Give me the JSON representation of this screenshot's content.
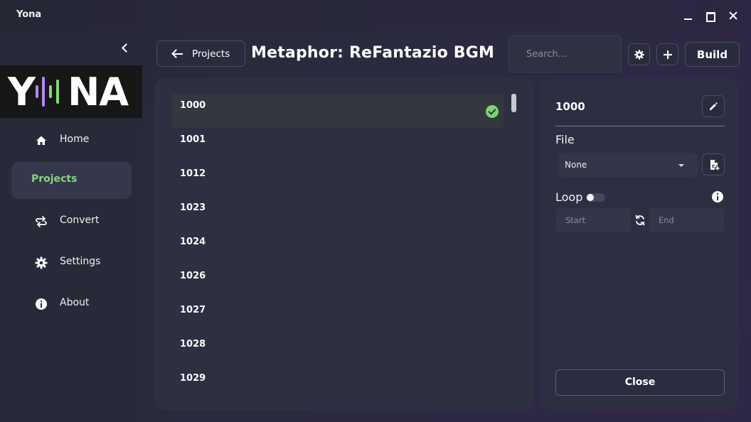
{
  "window": {
    "title": "Yona",
    "minimize_icon": "minimize-icon",
    "maximize_icon": "maximize-icon",
    "close_icon": "close-icon"
  },
  "sidebar": {
    "logo": {
      "left_text": "Y",
      "right_text": "NA",
      "wave_colors": [
        "#b486ef",
        "#8bd47f"
      ]
    },
    "items": [
      {
        "label": "Home",
        "icon": "home-icon",
        "active": false
      },
      {
        "label": "Projects",
        "icon": "",
        "active": true
      },
      {
        "label": "Convert",
        "icon": "convert-icon",
        "active": false
      },
      {
        "label": "Settings",
        "icon": "gear-icon",
        "active": false
      },
      {
        "label": "About",
        "icon": "info-icon",
        "active": false
      }
    ]
  },
  "toolbar": {
    "back_label": "Projects",
    "project_title": "Metaphor: ReFantazio BGM (…",
    "search_placeholder": "Search...",
    "build_label": "Build"
  },
  "list": {
    "items": [
      {
        "label": "1000",
        "selected": true,
        "done": true
      },
      {
        "label": "1001",
        "selected": false,
        "done": false
      },
      {
        "label": "1012",
        "selected": false,
        "done": false
      },
      {
        "label": "1023",
        "selected": false,
        "done": false
      },
      {
        "label": "1024",
        "selected": false,
        "done": false
      },
      {
        "label": "1026",
        "selected": false,
        "done": false
      },
      {
        "label": "1027",
        "selected": false,
        "done": false
      },
      {
        "label": "1028",
        "selected": false,
        "done": false
      },
      {
        "label": "1029",
        "selected": false,
        "done": false
      }
    ]
  },
  "detail": {
    "title": "1000",
    "file_label": "File",
    "file_value": "None",
    "loop_label": "Loop",
    "loop_enabled": false,
    "start_placeholder": "Start",
    "end_placeholder": "End",
    "close_label": "Close"
  },
  "colors": {
    "accent_green": "#8bd47f",
    "accent_purple": "#b486ef",
    "check_green": "#7fd36f"
  }
}
